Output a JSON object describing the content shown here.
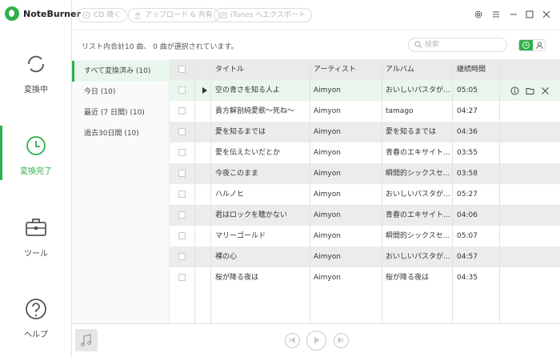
{
  "app": {
    "name": "NoteBurner"
  },
  "sidebar": {
    "items": [
      {
        "label": "変換中"
      },
      {
        "label": "変換完了"
      },
      {
        "label": "ツール"
      },
      {
        "label": "ヘルプ"
      }
    ],
    "active_index": 1
  },
  "toolbar": {
    "burn_cd": "CD 焼く",
    "upload_share": "アップロード & 共有",
    "itunes_export": "iTunes へエクスポート"
  },
  "summary": "リスト内合計10 曲、 0 曲が選択されています。",
  "search": {
    "placeholder": "検索",
    "value": ""
  },
  "filters": [
    {
      "label": "すべて変換済み (10)"
    },
    {
      "label": "今日 (10)"
    },
    {
      "label": "最近 (7 日間) (10)"
    },
    {
      "label": "過去30日間 (10)"
    }
  ],
  "table": {
    "columns": {
      "title": "タイトル",
      "artist": "アーティスト",
      "album": "アルバム",
      "duration": "継続時間"
    },
    "rows": [
      {
        "title": "空の青さを知る人よ",
        "artist": "Aimyon",
        "album": "おいしいパスタが...",
        "duration": "05:05"
      },
      {
        "title": "貴方解剖純愛歌～死ね～",
        "artist": "Aimyon",
        "album": "tamago",
        "duration": "04:27"
      },
      {
        "title": "愛を知るまでは",
        "artist": "Aimyon",
        "album": "愛を知るまでは",
        "duration": "04:36"
      },
      {
        "title": "愛を伝えたいだとか",
        "artist": "Aimyon",
        "album": "青春のエキサイト...",
        "duration": "03:55"
      },
      {
        "title": "今夜このまま",
        "artist": "Aimyon",
        "album": "瞬間的シックスセ...",
        "duration": "03:58"
      },
      {
        "title": "ハルノヒ",
        "artist": "Aimyon",
        "album": "おいしいパスタが...",
        "duration": "05:27"
      },
      {
        "title": "君はロックを聴かない",
        "artist": "Aimyon",
        "album": "青春のエキサイト...",
        "duration": "04:06"
      },
      {
        "title": "マリーゴールド",
        "artist": "Aimyon",
        "album": "瞬間的シックスセ...",
        "duration": "05:07"
      },
      {
        "title": "裸の心",
        "artist": "Aimyon",
        "album": "おいしいパスタが...",
        "duration": "04:57"
      },
      {
        "title": "桜が降る夜は",
        "artist": "Aimyon",
        "album": "桜が降る夜は",
        "duration": "04:35"
      }
    ]
  },
  "colors": {
    "accent": "#2db04b",
    "selected_row": "#e9f6ec",
    "alt_row": "#ececec"
  },
  "icons": {
    "row_actions": [
      "info-icon",
      "folder-icon",
      "close-icon"
    ],
    "player": [
      "previous-icon",
      "play-icon",
      "next-icon"
    ],
    "window": [
      "settings-icon",
      "menu-icon",
      "minimize-icon",
      "maximize-icon",
      "close-icon"
    ]
  }
}
